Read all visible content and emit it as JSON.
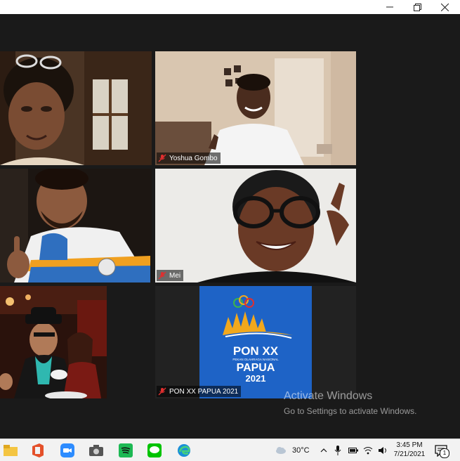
{
  "window": {
    "minimize_icon": "minimize-icon",
    "restore_icon": "restore-icon",
    "close_icon": "close-icon"
  },
  "participants": [
    {
      "name": "",
      "scene": "woman with sunglasses on head"
    },
    {
      "name": "Yoshua Gombo",
      "scene": "man in white shirt"
    },
    {
      "name": "",
      "scene": "man in jacket thumbs up"
    },
    {
      "name": "Mei",
      "scene": "woman with glasses"
    },
    {
      "name": "",
      "scene": "two people in cafe"
    },
    {
      "name": "PON XX PAPUA 2021",
      "scene": "logo"
    }
  ],
  "logo": {
    "line1": "PON XX",
    "line2": "PEKAN OLAHRAGA NASIONAL",
    "line3": "PAPUA",
    "line4": "2021"
  },
  "watermark": {
    "title": "Activate Windows",
    "subtitle": "Go to Settings to activate Windows."
  },
  "taskbar": {
    "apps": [
      "file-explorer-icon",
      "office-icon",
      "zoom-icon",
      "camera-icon",
      "spotify-icon",
      "line-icon",
      "edge-icon"
    ],
    "weather_temp": "30°C",
    "time": "3:45 PM",
    "date": "7/21/2021",
    "notification_count": "1"
  },
  "colors": {
    "accent_blue": "#1e63c6",
    "logo_gold": "#f2a81d",
    "mic_red": "#e02f2f"
  }
}
